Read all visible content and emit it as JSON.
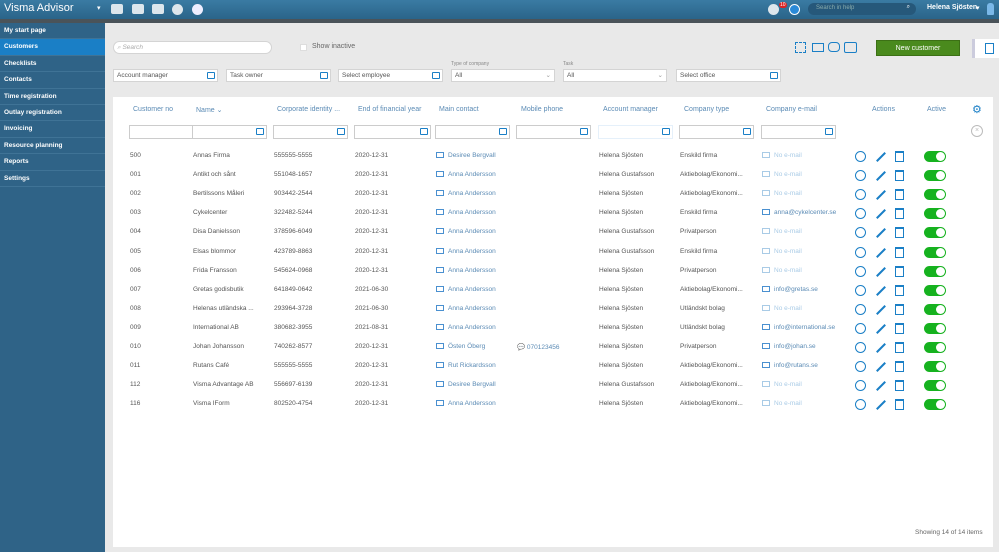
{
  "app": {
    "title": "Visma Advisor",
    "help_search_placeholder": "Search in help",
    "user": "Helena Sjösten",
    "notification_count": "10"
  },
  "sidebar": {
    "items": [
      {
        "label": "My start page"
      },
      {
        "label": "Customers",
        "active": true
      },
      {
        "label": "Checklists"
      },
      {
        "label": "Contacts"
      },
      {
        "label": "Time registration"
      },
      {
        "label": "Outlay registration"
      },
      {
        "label": "Invoicing"
      },
      {
        "label": "Resource planning"
      },
      {
        "label": "Reports"
      },
      {
        "label": "Settings"
      }
    ]
  },
  "toolbar": {
    "search_placeholder": "Search",
    "show_inactive": "Show inactive",
    "new_customer": "New customer"
  },
  "filters": {
    "account_manager": "Account manager",
    "task_owner": "Task owner",
    "select_employee": "Select employee",
    "type_label": "Type of company",
    "type_value": "All",
    "task_label": "Task",
    "task_value": "All",
    "select_office": "Select office"
  },
  "table": {
    "columns": [
      "Customer no",
      "Name",
      "Corporate identity ...",
      "End of financial year",
      "Main contact",
      "Mobile phone",
      "Account manager",
      "Company type",
      "Company e-mail",
      "Actions",
      "Active"
    ],
    "rows": [
      [
        "500",
        "Annas Firma",
        "555555-5555",
        "2020-12-31",
        "Desiree Bergvall",
        "",
        "Helena Sjösten",
        "Enskild firma",
        "No e-mail"
      ],
      [
        "001",
        "Antikt och sånt",
        "551048-1657",
        "2020-12-31",
        "Anna Andersson",
        "",
        "Helena Gustafsson",
        "Aktiebolag/Ekonomi...",
        "No e-mail"
      ],
      [
        "002",
        "Bertilssons Måleri",
        "903442-2544",
        "2020-12-31",
        "Anna Andersson",
        "",
        "Helena Sjösten",
        "Aktiebolag/Ekonomi...",
        "No e-mail"
      ],
      [
        "003",
        "Cykelcenter",
        "322482-5244",
        "2020-12-31",
        "Anna Andersson",
        "",
        "Helena Sjösten",
        "Enskild firma",
        "anna@cykelcenter.se"
      ],
      [
        "004",
        "Disa Danielsson",
        "378596-6049",
        "2020-12-31",
        "Anna Andersson",
        "",
        "Helena Gustafsson",
        "Privatperson",
        "No e-mail"
      ],
      [
        "005",
        "Elsas blommor",
        "423789-8863",
        "2020-12-31",
        "Anna Andersson",
        "",
        "Helena Gustafsson",
        "Enskild firma",
        "No e-mail"
      ],
      [
        "006",
        "Frida Fransson",
        "545624-0968",
        "2020-12-31",
        "Anna Andersson",
        "",
        "Helena Sjösten",
        "Privatperson",
        "No e-mail"
      ],
      [
        "007",
        "Gretas godisbutik",
        "641849-0642",
        "2021-06-30",
        "Anna Andersson",
        "",
        "Helena Sjösten",
        "Aktiebolag/Ekonomi...",
        "info@gretas.se"
      ],
      [
        "008",
        "Helenas utländska ...",
        "293964-3728",
        "2021-06-30",
        "Anna Andersson",
        "",
        "Helena Sjösten",
        "Utländskt bolag",
        "No e-mail"
      ],
      [
        "009",
        "International AB",
        "380682-3955",
        "2021-08-31",
        "Anna Andersson",
        "",
        "Helena Sjösten",
        "Utländskt bolag",
        "info@international.se"
      ],
      [
        "010",
        "Johan Johansson",
        "740262-8577",
        "2020-12-31",
        "Östen Öberg",
        "070123456",
        "Helena Sjösten",
        "Privatperson",
        "info@johan.se"
      ],
      [
        "011",
        "Rutans Café",
        "555555-5555",
        "2020-12-31",
        "Rut Rickardsson",
        "",
        "Helena Sjösten",
        "Aktiebolag/Ekonomi...",
        "info@rutans.se"
      ],
      [
        "112",
        "Visma Advantage AB",
        "556697-6139",
        "2020-12-31",
        "Desiree Bergvall",
        "",
        "Helena Gustafsson",
        "Aktiebolag/Ekonomi...",
        "No e-mail"
      ],
      [
        "116",
        "Visma IForm",
        "802520-4754",
        "2020-12-31",
        "Anna Andersson",
        "",
        "Helena Sjösten",
        "Aktiebolag/Ekonomi...",
        "No e-mail"
      ]
    ],
    "active": [
      true,
      true,
      true,
      true,
      true,
      true,
      true,
      true,
      true,
      true,
      true,
      true,
      true,
      true
    ]
  },
  "footer": {
    "status": "Showing 14 of 14 items"
  },
  "colors": {
    "accent": "#1a7fc6",
    "toggle_on": "#16b21f",
    "new_button": "#4a8a1d"
  }
}
